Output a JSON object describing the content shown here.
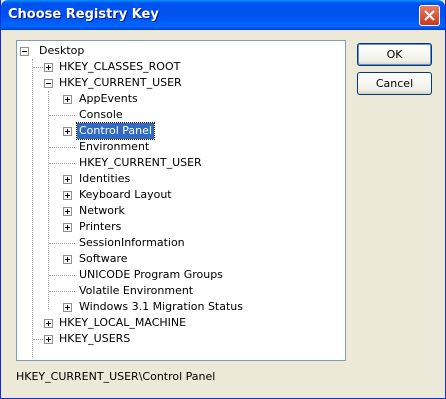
{
  "window": {
    "title": "Choose Registry Key"
  },
  "buttons": {
    "ok_label": "OK",
    "cancel_label": "Cancel"
  },
  "tree": {
    "root": "Desktop",
    "hives": [
      "HKEY_CLASSES_ROOT",
      "HKEY_CURRENT_USER",
      "HKEY_LOCAL_MACHINE",
      "HKEY_USERS"
    ],
    "current_user_children": [
      "AppEvents",
      "Console",
      "Control Panel",
      "Environment",
      "HKEY_CURRENT_USER",
      "Identities",
      "Keyboard Layout",
      "Network",
      "Printers",
      "SessionInformation",
      "Software",
      "UNICODE Program Groups",
      "Volatile Environment",
      "Windows 3.1 Migration Status"
    ],
    "selected": "Control Panel"
  },
  "status": {
    "path": "HKEY_CURRENT_USER\\Control Panel"
  }
}
